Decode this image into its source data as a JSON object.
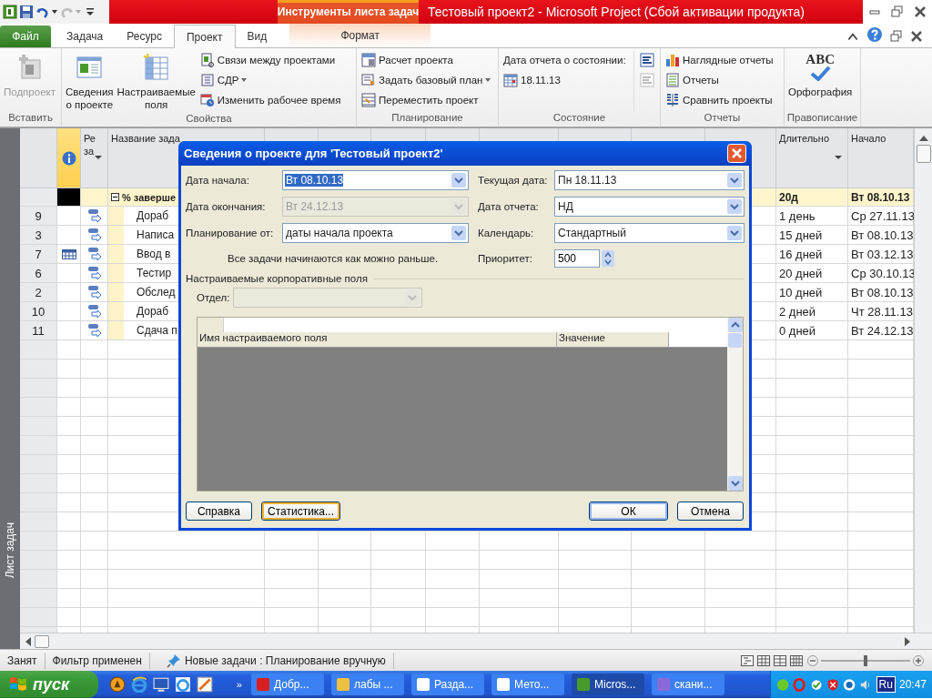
{
  "window": {
    "title": "Тестовый проект2  -  Microsoft Project (Сбой активации продукта)",
    "contextual_group": "Инструменты листа задач"
  },
  "tabs": [
    {
      "label": "Файл",
      "kind": "file",
      "selected": false
    },
    {
      "label": "Задача",
      "kind": "normal",
      "selected": false
    },
    {
      "label": "Ресурс",
      "kind": "normal",
      "selected": false
    },
    {
      "label": "Проект",
      "kind": "normal",
      "selected": true
    },
    {
      "label": "Вид",
      "kind": "normal",
      "selected": false
    },
    {
      "label": "Формат",
      "kind": "contextual",
      "selected": false
    }
  ],
  "ribbon": {
    "groups": [
      {
        "title": "Вставить",
        "items": [
          {
            "label": "Подпроект",
            "disabled": true
          }
        ]
      },
      {
        "title": "Свойства",
        "items": [
          {
            "label": "Сведения\nо проекте"
          },
          {
            "label": "Настраиваемые\nполя"
          },
          {
            "label": "Связи между проектами"
          },
          {
            "label": "СДР"
          },
          {
            "label": "Изменить рабочее время"
          }
        ]
      },
      {
        "title": "Планирование",
        "items": [
          {
            "label": "Расчет проекта"
          },
          {
            "label": "Задать базовый план"
          },
          {
            "label": "Переместить проект"
          }
        ]
      },
      {
        "title": "Состояние",
        "items": [
          {
            "label": "Дата отчета о состоянии:"
          },
          {
            "label": "18.11.13"
          }
        ],
        "buttons": [
          {
            "disabled": false
          },
          {
            "disabled": true
          }
        ]
      },
      {
        "title": "Отчеты",
        "items": [
          {
            "label": "Наглядные отчеты"
          },
          {
            "label": "Отчеты"
          },
          {
            "label": "Сравнить проекты"
          }
        ]
      },
      {
        "title": "Правописание",
        "items": [
          {
            "label": "Орфография",
            "icon_text": "ABC"
          }
        ]
      }
    ]
  },
  "task_sheet": {
    "side_label": "Лист задач",
    "columns": [
      {
        "label": "Ре\nза"
      },
      {
        "label": "Название зада"
      },
      {
        "label": "Длительно"
      },
      {
        "label": "Начало"
      }
    ],
    "summary": {
      "name": "% заверше",
      "duration": "20д",
      "start": "Вт 08.10.13",
      "expanded": true
    },
    "rows": [
      {
        "id": "9",
        "calendar": false,
        "name": "Дораб",
        "duration": "1 день",
        "start": "Ср 27.11.13"
      },
      {
        "id": "3",
        "calendar": false,
        "name": "Написа",
        "duration": "15 дней",
        "start": "Вт 08.10.13"
      },
      {
        "id": "7",
        "calendar": true,
        "name": "Ввод в",
        "duration": "16 дней",
        "start": "Вт 03.12.13"
      },
      {
        "id": "6",
        "calendar": false,
        "name": "Тестир",
        "duration": "20 дней",
        "start": "Ср 30.10.13"
      },
      {
        "id": "2",
        "calendar": false,
        "name": "Обслед",
        "duration": "10 дней",
        "start": "Вт 08.10.13"
      },
      {
        "id": "10",
        "calendar": false,
        "name": "Дораб",
        "duration": "2 дней",
        "start": "Чт 28.11.13"
      },
      {
        "id": "11",
        "calendar": false,
        "name": "Сдача п",
        "duration": "0 дней",
        "start": "Вт 24.12.13"
      }
    ]
  },
  "dialog": {
    "title": "Сведения о проекте для 'Тестовый проект2'",
    "fields": [
      {
        "label": "Дата начала:",
        "value": "Вт 08.10.13",
        "disabled": false,
        "selected": true
      },
      {
        "label": "Текущая дата:",
        "value": "Пн 18.11.13",
        "disabled": false,
        "selected": false
      },
      {
        "label": "Дата окончания:",
        "value": "Вт 24.12.13",
        "disabled": true,
        "selected": false
      },
      {
        "label": "Дата отчета:",
        "value": "НД",
        "disabled": false,
        "selected": false
      },
      {
        "label": "Планирование от:",
        "value": "даты начала проекта",
        "disabled": false,
        "selected": false
      },
      {
        "label": "Календарь:",
        "value": "Стандартный",
        "disabled": false,
        "selected": false
      }
    ],
    "note": "Все задачи начинаются как можно раньше.",
    "priority": {
      "label": "Приоритет:",
      "value": "500"
    },
    "enterprise": {
      "title": "Настраиваемые корпоративные поля",
      "department": {
        "label": "Отдел:",
        "disabled": true
      },
      "columns": [
        "Имя настраиваемого поля",
        "Значение"
      ]
    },
    "buttons": [
      {
        "label": "Справка",
        "kind": "normal"
      },
      {
        "label": "Статистика...",
        "kind": "focused"
      },
      {
        "label": "ОК",
        "kind": "default"
      },
      {
        "label": "Отмена",
        "kind": "normal"
      }
    ]
  },
  "status_bar": {
    "items": [
      "Занят",
      "Фильтр применен",
      "Новые задачи : Планирование вручную"
    ],
    "zoom": {
      "level": 0.5
    }
  },
  "taskbar": {
    "start": "пуск",
    "more": "»",
    "tasks": [
      {
        "label": "Добр...",
        "selected": false
      },
      {
        "label": "лабы ...",
        "selected": false
      },
      {
        "label": "Разда...",
        "selected": false
      },
      {
        "label": "Мето...",
        "selected": false
      },
      {
        "label": "Micros...",
        "selected": true
      },
      {
        "label": "скани...",
        "selected": false
      }
    ],
    "language": "Ru",
    "clock": "20:47"
  }
}
